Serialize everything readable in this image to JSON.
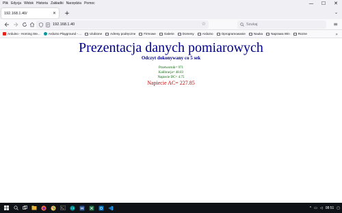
{
  "menubar": {
    "items": [
      "Plik",
      "Edycja",
      "Widok",
      "Historia",
      "Zakładki",
      "Narzędzia",
      "Pomoc"
    ]
  },
  "window_controls": {
    "minimize": "—",
    "maximize": "☐",
    "close": "✕"
  },
  "tab": {
    "title": "192.168.1.40/",
    "close": "✕"
  },
  "newtab": "+",
  "tablist": "⌄",
  "navbar": {
    "url": "192.168.1.40",
    "search_placeholder": "Szukaj"
  },
  "bookmarks": [
    {
      "label": "Arduino - Homing Ste...",
      "type": "site",
      "color": "#e62117"
    },
    {
      "label": "Arduino Playground - ...",
      "type": "site",
      "color": "#00979c"
    },
    {
      "label": "Ulubione",
      "type": "folder"
    },
    {
      "label": "Adresy podręczne",
      "type": "folder"
    },
    {
      "label": "Firmowe",
      "type": "folder"
    },
    {
      "label": "Galerie",
      "type": "folder"
    },
    {
      "label": "Domeny",
      "type": "folder"
    },
    {
      "label": "Arduino",
      "type": "folder"
    },
    {
      "label": "Oprogramowanie",
      "type": "folder"
    },
    {
      "label": "Nauka",
      "type": "folder"
    },
    {
      "label": "Naprawa Win",
      "type": "folder"
    },
    {
      "label": "Rozne",
      "type": "folder"
    }
  ],
  "page": {
    "title": "Prezentacja danych pomiarowych",
    "subtitle": "Odczyt dokonywany co 5 sek",
    "przetwornik": "Przetwornik= 971",
    "kalibracja": "Kalibracja= 48.03",
    "napiecie_dc": "Napiecie DC= 4.75",
    "napiecie_ac": "Napiecie AC= 227.85"
  },
  "taskbar": {
    "time": "08:51"
  },
  "colors": {
    "title": "#00008b",
    "green": "#006400",
    "red": "#cc0000",
    "taskbar": "#0f1217"
  }
}
